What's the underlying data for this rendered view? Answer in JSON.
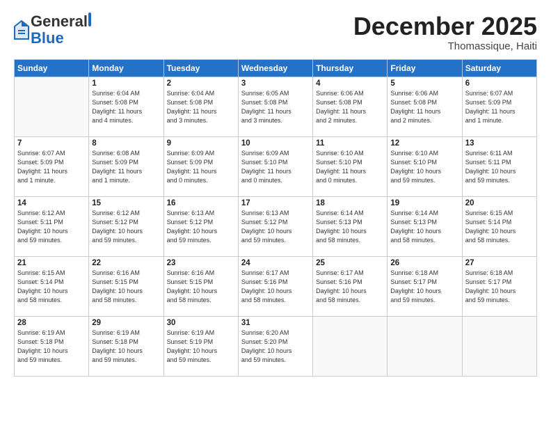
{
  "header": {
    "logo_general": "General",
    "logo_blue": "Blue",
    "month_title": "December 2025",
    "location": "Thomassique, Haiti"
  },
  "days_of_week": [
    "Sunday",
    "Monday",
    "Tuesday",
    "Wednesday",
    "Thursday",
    "Friday",
    "Saturday"
  ],
  "weeks": [
    [
      {
        "day": "",
        "info": ""
      },
      {
        "day": "1",
        "info": "Sunrise: 6:04 AM\nSunset: 5:08 PM\nDaylight: 11 hours\nand 4 minutes."
      },
      {
        "day": "2",
        "info": "Sunrise: 6:04 AM\nSunset: 5:08 PM\nDaylight: 11 hours\nand 3 minutes."
      },
      {
        "day": "3",
        "info": "Sunrise: 6:05 AM\nSunset: 5:08 PM\nDaylight: 11 hours\nand 3 minutes."
      },
      {
        "day": "4",
        "info": "Sunrise: 6:06 AM\nSunset: 5:08 PM\nDaylight: 11 hours\nand 2 minutes."
      },
      {
        "day": "5",
        "info": "Sunrise: 6:06 AM\nSunset: 5:08 PM\nDaylight: 11 hours\nand 2 minutes."
      },
      {
        "day": "6",
        "info": "Sunrise: 6:07 AM\nSunset: 5:09 PM\nDaylight: 11 hours\nand 1 minute."
      }
    ],
    [
      {
        "day": "7",
        "info": "Sunrise: 6:07 AM\nSunset: 5:09 PM\nDaylight: 11 hours\nand 1 minute."
      },
      {
        "day": "8",
        "info": "Sunrise: 6:08 AM\nSunset: 5:09 PM\nDaylight: 11 hours\nand 1 minute."
      },
      {
        "day": "9",
        "info": "Sunrise: 6:09 AM\nSunset: 5:09 PM\nDaylight: 11 hours\nand 0 minutes."
      },
      {
        "day": "10",
        "info": "Sunrise: 6:09 AM\nSunset: 5:10 PM\nDaylight: 11 hours\nand 0 minutes."
      },
      {
        "day": "11",
        "info": "Sunrise: 6:10 AM\nSunset: 5:10 PM\nDaylight: 11 hours\nand 0 minutes."
      },
      {
        "day": "12",
        "info": "Sunrise: 6:10 AM\nSunset: 5:10 PM\nDaylight: 10 hours\nand 59 minutes."
      },
      {
        "day": "13",
        "info": "Sunrise: 6:11 AM\nSunset: 5:11 PM\nDaylight: 10 hours\nand 59 minutes."
      }
    ],
    [
      {
        "day": "14",
        "info": "Sunrise: 6:12 AM\nSunset: 5:11 PM\nDaylight: 10 hours\nand 59 minutes."
      },
      {
        "day": "15",
        "info": "Sunrise: 6:12 AM\nSunset: 5:12 PM\nDaylight: 10 hours\nand 59 minutes."
      },
      {
        "day": "16",
        "info": "Sunrise: 6:13 AM\nSunset: 5:12 PM\nDaylight: 10 hours\nand 59 minutes."
      },
      {
        "day": "17",
        "info": "Sunrise: 6:13 AM\nSunset: 5:12 PM\nDaylight: 10 hours\nand 59 minutes."
      },
      {
        "day": "18",
        "info": "Sunrise: 6:14 AM\nSunset: 5:13 PM\nDaylight: 10 hours\nand 58 minutes."
      },
      {
        "day": "19",
        "info": "Sunrise: 6:14 AM\nSunset: 5:13 PM\nDaylight: 10 hours\nand 58 minutes."
      },
      {
        "day": "20",
        "info": "Sunrise: 6:15 AM\nSunset: 5:14 PM\nDaylight: 10 hours\nand 58 minutes."
      }
    ],
    [
      {
        "day": "21",
        "info": "Sunrise: 6:15 AM\nSunset: 5:14 PM\nDaylight: 10 hours\nand 58 minutes."
      },
      {
        "day": "22",
        "info": "Sunrise: 6:16 AM\nSunset: 5:15 PM\nDaylight: 10 hours\nand 58 minutes."
      },
      {
        "day": "23",
        "info": "Sunrise: 6:16 AM\nSunset: 5:15 PM\nDaylight: 10 hours\nand 58 minutes."
      },
      {
        "day": "24",
        "info": "Sunrise: 6:17 AM\nSunset: 5:16 PM\nDaylight: 10 hours\nand 58 minutes."
      },
      {
        "day": "25",
        "info": "Sunrise: 6:17 AM\nSunset: 5:16 PM\nDaylight: 10 hours\nand 58 minutes."
      },
      {
        "day": "26",
        "info": "Sunrise: 6:18 AM\nSunset: 5:17 PM\nDaylight: 10 hours\nand 59 minutes."
      },
      {
        "day": "27",
        "info": "Sunrise: 6:18 AM\nSunset: 5:17 PM\nDaylight: 10 hours\nand 59 minutes."
      }
    ],
    [
      {
        "day": "28",
        "info": "Sunrise: 6:19 AM\nSunset: 5:18 PM\nDaylight: 10 hours\nand 59 minutes."
      },
      {
        "day": "29",
        "info": "Sunrise: 6:19 AM\nSunset: 5:18 PM\nDaylight: 10 hours\nand 59 minutes."
      },
      {
        "day": "30",
        "info": "Sunrise: 6:19 AM\nSunset: 5:19 PM\nDaylight: 10 hours\nand 59 minutes."
      },
      {
        "day": "31",
        "info": "Sunrise: 6:20 AM\nSunset: 5:20 PM\nDaylight: 10 hours\nand 59 minutes."
      },
      {
        "day": "",
        "info": ""
      },
      {
        "day": "",
        "info": ""
      },
      {
        "day": "",
        "info": ""
      }
    ]
  ]
}
